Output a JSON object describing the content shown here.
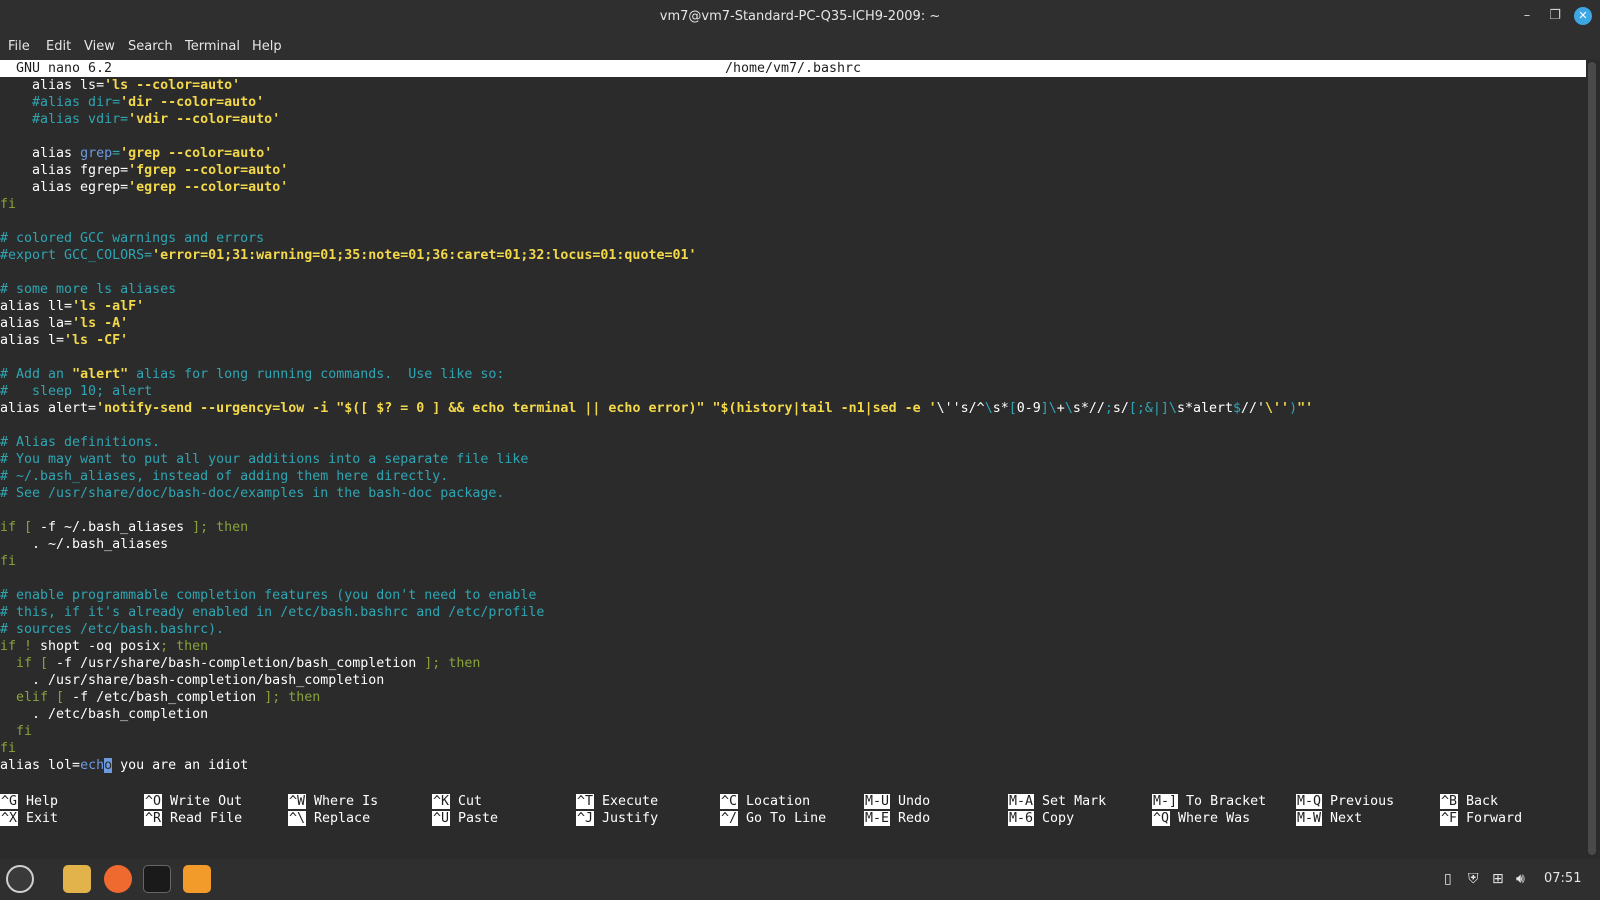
{
  "window": {
    "title": "vm7@vm7-Standard-PC-Q35-ICH9-2009: ~",
    "minimize": "–",
    "maximize": "❐",
    "close": "✕"
  },
  "menu": [
    "File",
    "Edit",
    "View",
    "Search",
    "Terminal",
    "Help"
  ],
  "nano": {
    "version": "GNU nano 6.2",
    "filename": "/home/vm7/.bashrc"
  },
  "editor_lines": [
    [
      [
        "    alias ls=",
        ""
      ],
      [
        "'ls --color=auto'",
        "s"
      ]
    ],
    [
      [
        "    #alias dir=",
        "c"
      ],
      [
        "'dir --color=auto'",
        "s"
      ]
    ],
    [
      [
        "    #alias vdir=",
        "c"
      ],
      [
        "'vdir --color=auto'",
        "s"
      ]
    ],
    [
      [
        "",
        ""
      ]
    ],
    [
      [
        "    alias ",
        ""
      ],
      [
        "grep",
        "v"
      ],
      [
        "=",
        "c"
      ],
      [
        "'grep --color=auto'",
        "s"
      ]
    ],
    [
      [
        "    alias fgrep=",
        ""
      ],
      [
        "'fgrep --color=auto'",
        "s"
      ]
    ],
    [
      [
        "    alias egrep=",
        ""
      ],
      [
        "'egrep --color=auto'",
        "s"
      ]
    ],
    [
      [
        "fi",
        "k"
      ]
    ],
    [
      [
        "",
        ""
      ]
    ],
    [
      [
        "# colored GCC warnings and errors",
        "c"
      ]
    ],
    [
      [
        "#export GCC_COLORS=",
        "c"
      ],
      [
        "'error=01;31:warning=01;35:note=01;36:caret=01;32:locus=01:quote=01'",
        "s"
      ]
    ],
    [
      [
        "",
        ""
      ]
    ],
    [
      [
        "# some more ls aliases",
        "c"
      ]
    ],
    [
      [
        "alias ll=",
        ""
      ],
      [
        "'ls -alF'",
        "s"
      ]
    ],
    [
      [
        "alias la=",
        ""
      ],
      [
        "'ls -A'",
        "s"
      ]
    ],
    [
      [
        "alias l=",
        ""
      ],
      [
        "'ls -CF'",
        "s"
      ]
    ],
    [
      [
        "",
        ""
      ]
    ],
    [
      [
        "# Add an ",
        "c"
      ],
      [
        "\"alert\"",
        "s"
      ],
      [
        " alias for long running commands.  Use like so:",
        "c"
      ]
    ],
    [
      [
        "#   sleep 10; alert",
        "c"
      ]
    ],
    [
      [
        "alias alert=",
        ""
      ],
      [
        "'notify-send --urgency=low -i \"$([ $? = 0 ] && echo terminal || echo error)\" \"$(history|tail -n1|sed -e '",
        "s"
      ],
      [
        "\\''s/^",
        ""
      ],
      [
        "\\",
        "c"
      ],
      [
        "s*",
        ""
      ],
      [
        "[",
        "c"
      ],
      [
        "0-9",
        ""
      ],
      [
        "]\\",
        "c"
      ],
      [
        "+",
        ""
      ],
      [
        "\\",
        "c"
      ],
      [
        "s*//",
        ""
      ],
      [
        ";",
        "c"
      ],
      [
        "s/",
        ""
      ],
      [
        "[;&|]\\",
        "c"
      ],
      [
        "s*alert",
        ""
      ],
      [
        "$",
        "c"
      ],
      [
        "//'",
        ""
      ],
      [
        "\\''",
        "s"
      ],
      [
        ")",
        "c"
      ],
      [
        "\"'",
        "s"
      ]
    ],
    [
      [
        "",
        ""
      ]
    ],
    [
      [
        "# Alias definitions.",
        "c"
      ]
    ],
    [
      [
        "# You may want to put all your additions into a separate file like",
        "c"
      ]
    ],
    [
      [
        "# ~/.bash_aliases, instead of adding them here directly.",
        "c"
      ]
    ],
    [
      [
        "# See /usr/share/doc/bash-doc/examples in the bash-doc package.",
        "c"
      ]
    ],
    [
      [
        "",
        ""
      ]
    ],
    [
      [
        "if [ ",
        "k"
      ],
      [
        "-f ~/.bash_aliases ",
        ""
      ],
      [
        "]; then",
        "k"
      ]
    ],
    [
      [
        "    . ~/.bash_aliases",
        ""
      ]
    ],
    [
      [
        "fi",
        "k"
      ]
    ],
    [
      [
        "",
        ""
      ]
    ],
    [
      [
        "# enable programmable completion features (you don't need to enable",
        "c"
      ]
    ],
    [
      [
        "# this, if it's already enabled in /etc/bash.bashrc and /etc/profile",
        "c"
      ]
    ],
    [
      [
        "# sources /etc/bash.bashrc).",
        "c"
      ]
    ],
    [
      [
        "if ! ",
        "k"
      ],
      [
        "shopt -oq posix",
        ""
      ],
      [
        "; then",
        "k"
      ]
    ],
    [
      [
        "  if [ ",
        "k"
      ],
      [
        "-f /usr/share/bash-completion/bash_completion ",
        ""
      ],
      [
        "]; then",
        "k"
      ]
    ],
    [
      [
        "    . /usr/share/bash-completion/bash_completion",
        ""
      ]
    ],
    [
      [
        "  elif [ ",
        "k"
      ],
      [
        "-f /etc/bash_completion ",
        ""
      ],
      [
        "]; then",
        "k"
      ]
    ],
    [
      [
        "    . /etc/bash_completion",
        ""
      ]
    ],
    [
      [
        "  fi",
        "k"
      ]
    ],
    [
      [
        "fi",
        "k"
      ]
    ],
    [
      [
        "alias lol=",
        ""
      ],
      [
        "ech",
        "v"
      ],
      [
        "o",
        "cursor"
      ],
      [
        " you are an idiot",
        ""
      ]
    ]
  ],
  "shortcuts": [
    {
      "key": "^G",
      "label": "Help"
    },
    {
      "key": "^X",
      "label": "Exit"
    },
    {
      "key": "^O",
      "label": "Write Out"
    },
    {
      "key": "^R",
      "label": "Read File"
    },
    {
      "key": "^W",
      "label": "Where Is"
    },
    {
      "key": "^\\",
      "label": "Replace"
    },
    {
      "key": "^K",
      "label": "Cut"
    },
    {
      "key": "^U",
      "label": "Paste"
    },
    {
      "key": "^T",
      "label": "Execute"
    },
    {
      "key": "^J",
      "label": "Justify"
    },
    {
      "key": "^C",
      "label": "Location"
    },
    {
      "key": "^/",
      "label": "Go To Line"
    },
    {
      "key": "M-U",
      "label": "Undo"
    },
    {
      "key": "M-E",
      "label": "Redo"
    },
    {
      "key": "M-A",
      "label": "Set Mark"
    },
    {
      "key": "M-6",
      "label": "Copy"
    },
    {
      "key": "M-]",
      "label": "To Bracket"
    },
    {
      "key": "^Q",
      "label": "Where Was"
    },
    {
      "key": "M-Q",
      "label": "Previous"
    },
    {
      "key": "M-W",
      "label": "Next"
    },
    {
      "key": "^B",
      "label": "Back"
    },
    {
      "key": "^F",
      "label": "Forward"
    }
  ],
  "taskbar": {
    "apps": [
      "mint-menu-icon",
      "files-icon",
      "firefox-icon",
      "terminal-icon",
      "info-icon"
    ],
    "clock": "07:51"
  },
  "colors": {
    "terminal_bg": "#2b2b2b",
    "comment": "#2fa5b3",
    "string": "#f3d84b",
    "keyword": "#89a23a",
    "accent": "#3da6e4"
  }
}
